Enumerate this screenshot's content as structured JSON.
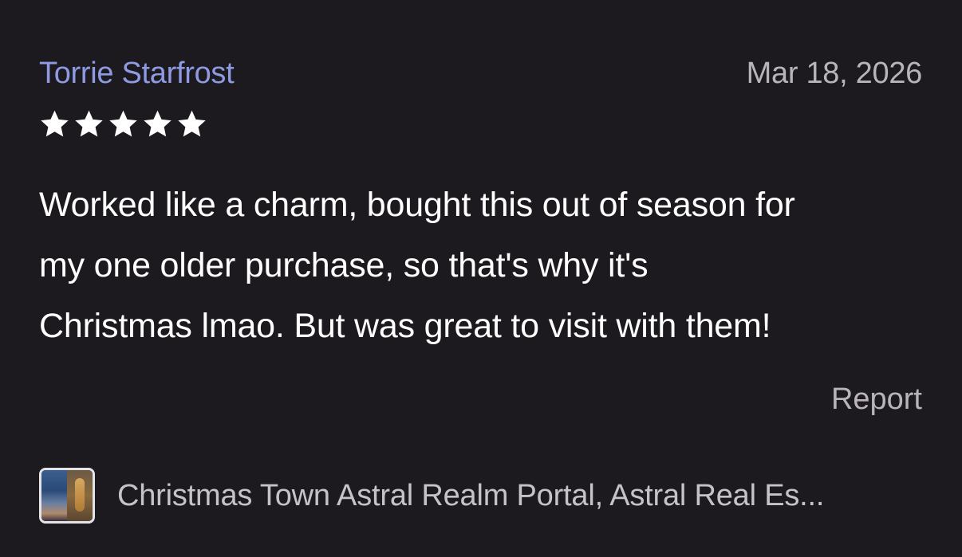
{
  "review": {
    "reviewer_name": "Torrie Starfrost",
    "date": "Mar 18, 2026",
    "rating": 5,
    "rating_max": 5,
    "text_lines": [
      "Worked like a charm, bought this out of season for",
      "my one older purchase, so that's why it's",
      "Christmas lmao. But was great to visit with them!"
    ],
    "report_label": "Report"
  },
  "listing": {
    "title": "Christmas Town Astral Realm Portal, Astral Real Es..."
  },
  "colors": {
    "background": "#1c1a1e",
    "reviewer_name": "#8e9be3",
    "muted_text": "#b9b4bb",
    "star": "#ffffff"
  },
  "icons": {
    "star": "star-icon"
  }
}
